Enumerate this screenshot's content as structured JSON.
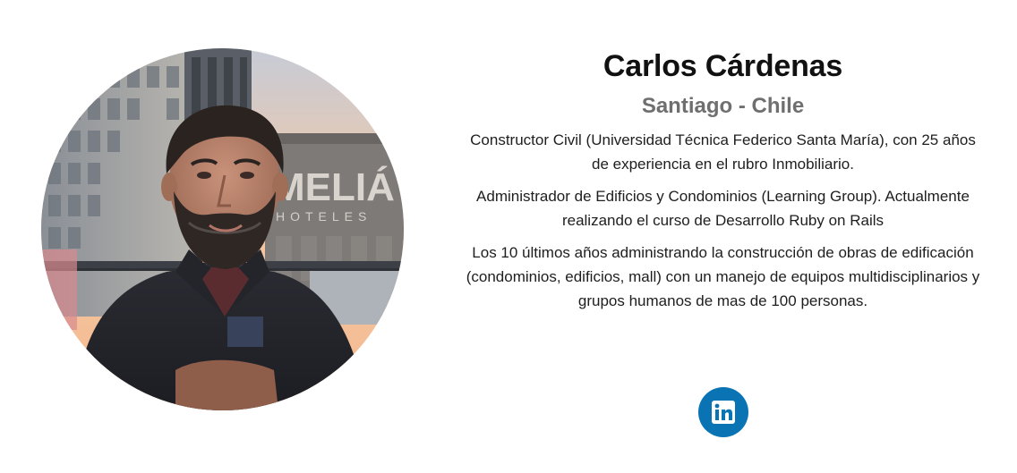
{
  "profile": {
    "name": "Carlos Cárdenas",
    "location": "Santiago - Chile",
    "bio": [
      "Constructor Civil (Universidad Técnica Federico Santa María), con 25 años de experiencia en el rubro Inmobiliario.",
      "Administrador de Edificios y Condominios (Learning Group). Actualmente realizando el curso de Desarrollo Ruby on Rails",
      "Los 10 últimos años administrando la construcción de obras de edificación (condominios, edificios, mall) con un manejo de equipos multidisciplinarios y grupos humanos de mas de 100 personas."
    ],
    "photo_sign": "MELIÁ",
    "photo_sign_sub": "HOTELES"
  },
  "social": {
    "icon": "linkedin-icon",
    "color": "#0a73b3"
  }
}
